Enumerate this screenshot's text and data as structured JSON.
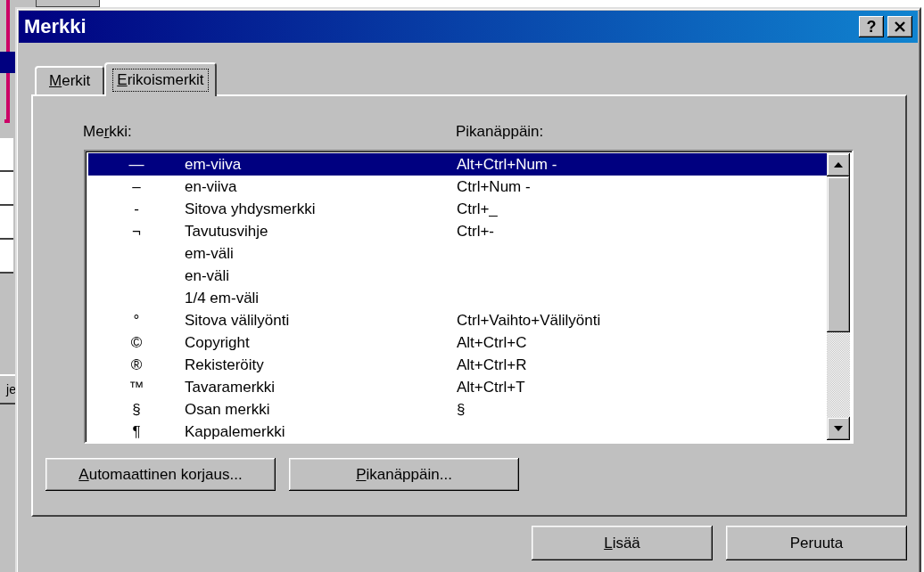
{
  "background": {
    "button_fragment": "je"
  },
  "window": {
    "title": "Merkki",
    "help_button": "?"
  },
  "tabs": [
    {
      "label": {
        "key": "M",
        "after": "erkit"
      },
      "selected": false
    },
    {
      "label": {
        "key": "E",
        "after": "rikoismerkit"
      },
      "selected": true
    }
  ],
  "list": {
    "column_label": {
      "before": "Me",
      "key": "r",
      "after": "kki:"
    },
    "shortcut_label": {
      "before": "Pikanäppäin:"
    },
    "rows": [
      {
        "symbol": "—",
        "name": "em-viiva",
        "shortcut": "Alt+Ctrl+Num -",
        "selected": true
      },
      {
        "symbol": "–",
        "name": "en-viiva",
        "shortcut": "Ctrl+Num -",
        "selected": false
      },
      {
        "symbol": "-",
        "name": "Sitova yhdysmerkki",
        "shortcut": "Ctrl+_",
        "selected": false
      },
      {
        "symbol": "¬",
        "name": "Tavutusvihje",
        "shortcut": "Ctrl+-",
        "selected": false
      },
      {
        "name": "em-väli",
        "selected": false
      },
      {
        "name": "en-väli",
        "selected": false
      },
      {
        "name": "1/4 em-väli",
        "selected": false
      },
      {
        "symbol": "°",
        "name": "Sitova välilyönti",
        "shortcut": "Ctrl+Vaihto+Välilyönti",
        "selected": false
      },
      {
        "symbol": "©",
        "name": "Copyright",
        "shortcut": "Alt+Ctrl+C",
        "selected": false
      },
      {
        "symbol": "®",
        "name": "Rekisteröity",
        "shortcut": "Alt+Ctrl+R",
        "selected": false
      },
      {
        "symbol": "™",
        "name": "Tavaramerkki",
        "shortcut": "Alt+Ctrl+T",
        "selected": false
      },
      {
        "symbol": "§",
        "name": "Osan merkki",
        "shortcut": "§",
        "selected": false
      },
      {
        "symbol": "¶",
        "name": "Kappalemerkki",
        "selected": false
      }
    ]
  },
  "panel_buttons": [
    {
      "key": "A",
      "after": "utomaattinen korjaus..."
    },
    {
      "key": "P",
      "after": "ikanäppäin..."
    }
  ],
  "dialog_buttons": [
    {
      "key": "L",
      "after": "isää"
    },
    {
      "before": "Peruuta"
    }
  ]
}
